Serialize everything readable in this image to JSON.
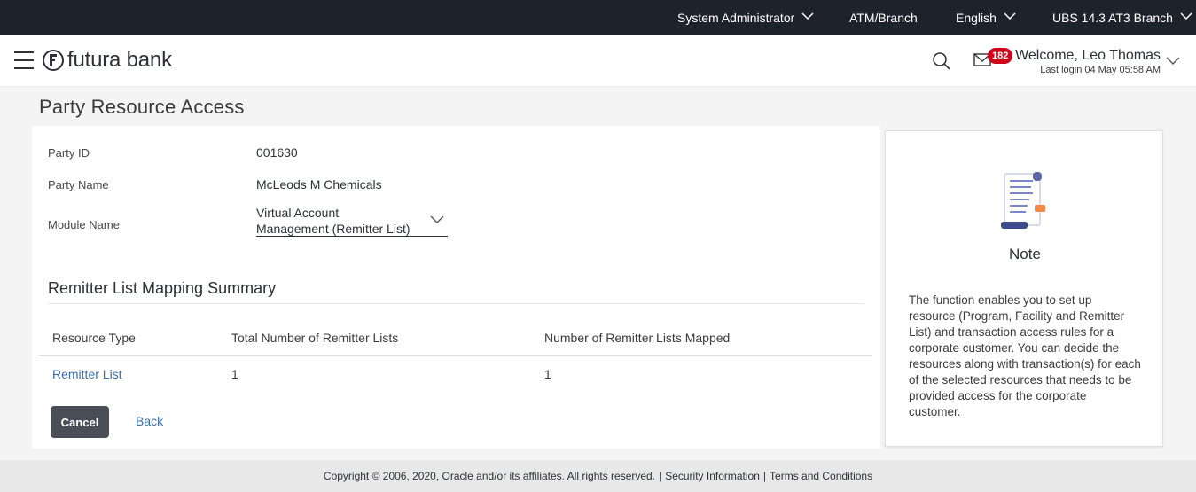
{
  "topbar": {
    "role": "System Administrator",
    "atm_branch": "ATM/Branch",
    "language": "English",
    "branch": "UBS 14.3 AT3 Branch"
  },
  "header": {
    "logo_text": "futura bank",
    "notification_count": "182",
    "welcome": "Welcome, Leo Thomas",
    "last_login": "Last login 04 May 05:58 AM"
  },
  "page": {
    "title": "Party Resource Access"
  },
  "form": {
    "party_id_label": "Party ID",
    "party_id_value": "001630",
    "party_name_label": "Party Name",
    "party_name_value": "McLeods M Chemicals",
    "module_name_label": "Module Name",
    "module_name_line1": "Virtual Account",
    "module_name_line2": "Management (Remitter List)"
  },
  "summary": {
    "title": "Remitter List Mapping Summary",
    "columns": [
      "Resource Type",
      "Total Number of Remitter Lists",
      "Number of Remitter Lists Mapped"
    ],
    "rows": [
      {
        "resource_type": "Remitter List",
        "total": "1",
        "mapped": "1"
      }
    ]
  },
  "actions": {
    "cancel": "Cancel",
    "back": "Back"
  },
  "note": {
    "title": "Note",
    "text": "The function enables you to set up resource (Program, Facility and Remitter List) and transaction access rules for a corporate customer. You can decide the resources along with transaction(s) for each of the selected resources that needs to be provided access for the corporate customer."
  },
  "footer": {
    "copyright": "Copyright © 2006, 2020, Oracle and/or its affiliates. All rights reserved.",
    "security": "Security Information",
    "terms": "Terms and Conditions"
  },
  "colors": {
    "topbar": "#1e232b",
    "link": "#3b6fa8",
    "badge": "#d0021b",
    "button": "#4a4f57"
  }
}
